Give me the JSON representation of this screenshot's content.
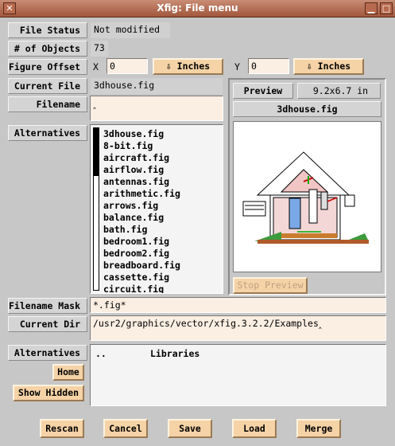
{
  "window": {
    "title": "Xfig: File menu"
  },
  "file_status": {
    "label": "File Status",
    "value": "Not modified"
  },
  "num_objects": {
    "label": "# of Objects",
    "value": "73"
  },
  "figure_offset": {
    "label": "Figure Offset",
    "x_label": "X",
    "x_value": "0",
    "x_units": "Inches",
    "y_label": "Y",
    "y_value": "0",
    "y_units": "Inches"
  },
  "current_file": {
    "label": "Current File",
    "value": "3dhouse.fig"
  },
  "filename": {
    "label": "Filename",
    "value": ""
  },
  "alternatives": {
    "label": "Alternatives",
    "files": [
      "3dhouse.fig",
      "8-bit.fig",
      "aircraft.fig",
      "airflow.fig",
      "antennas.fig",
      "arithmetic.fig",
      "arrows.fig",
      "balance.fig",
      "bath.fig",
      "bedroom1.fig",
      "bedroom2.fig",
      "breadboard.fig",
      "cassette.fig",
      "circuit.fig"
    ]
  },
  "preview": {
    "label": "Preview",
    "size": "9.2x6.7 in",
    "filename": "3dhouse.fig",
    "stop_label": "Stop Preview"
  },
  "filename_mask": {
    "label": "Filename Mask",
    "value": "*.fig*"
  },
  "current_dir": {
    "label": "Current Dir",
    "value": "/usr2/graphics/vector/xfig.3.2.2/Examples"
  },
  "dir_alternatives": {
    "label": "Alternatives",
    "items": [
      "..",
      "Libraries"
    ],
    "home_label": "Home",
    "show_hidden_label": "Show Hidden"
  },
  "buttons": {
    "rescan": "Rescan",
    "cancel": "Cancel",
    "save": "Save",
    "load": "Load",
    "merge": "Merge"
  },
  "colors": {
    "field_bg": "#fbeee2",
    "button_bg": "#f5d3a7",
    "title_bg": "#a0573c"
  }
}
